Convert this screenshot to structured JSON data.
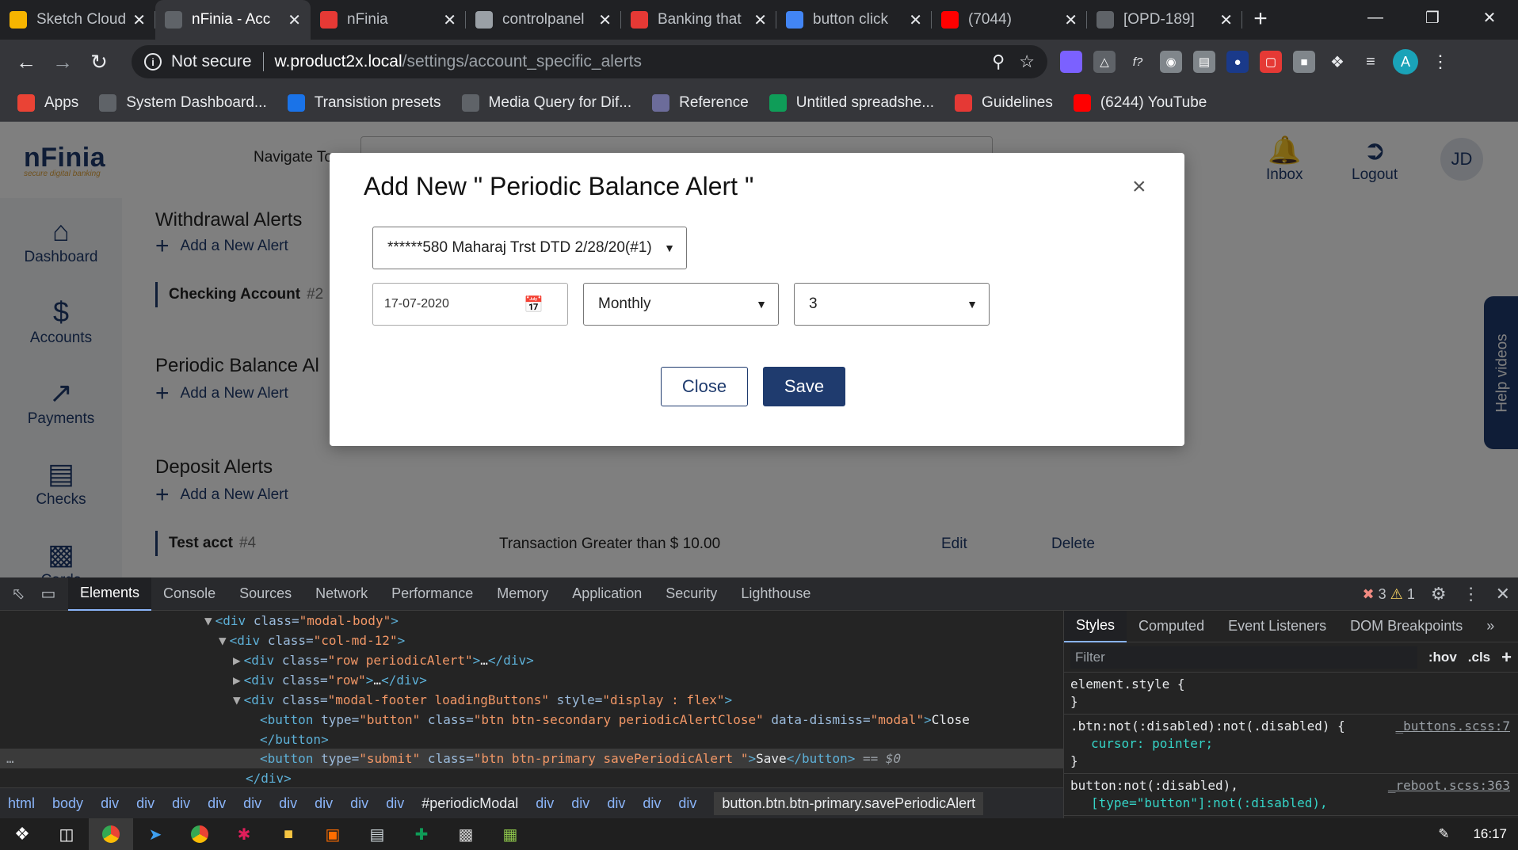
{
  "browser": {
    "tabs": [
      {
        "label": "Sketch Cloud",
        "color": "#f7b500",
        "active": false
      },
      {
        "label": "nFinia - Acc",
        "color": "#5f6368",
        "active": true
      },
      {
        "label": "nFinia",
        "color": "#e53935",
        "active": false
      },
      {
        "label": "controlpanel",
        "color": "#9aa0a6",
        "active": false
      },
      {
        "label": "Banking that",
        "color": "#e53935",
        "active": false
      },
      {
        "label": "button click",
        "color": "#4285f4",
        "active": false
      },
      {
        "label": "(7044)",
        "color": "#ff0000",
        "active": false
      },
      {
        "label": "[OPD-189]",
        "color": "#5f6368",
        "active": false
      }
    ],
    "address": {
      "security": "Not secure",
      "host": "w.product2x.local",
      "path": "/settings/account_specific_alerts"
    },
    "bookmarks": [
      {
        "label": "Apps",
        "color": "#ea4335"
      },
      {
        "label": "System Dashboard...",
        "color": "#5f6368"
      },
      {
        "label": "Transistion presets",
        "color": "#1a73e8"
      },
      {
        "label": "Media Query for Dif...",
        "color": "#5f6368"
      },
      {
        "label": "Reference",
        "color": "#6c6c9a"
      },
      {
        "label": "Untitled spreadshe...",
        "color": "#0f9d58"
      },
      {
        "label": "Guidelines",
        "color": "#e53935"
      },
      {
        "label": "(6244) YouTube",
        "color": "#ff0000"
      }
    ],
    "profile_initial": "A"
  },
  "app": {
    "logo": "nFinia",
    "tagline": "secure digital banking",
    "navigate_label": "Navigate To",
    "header": {
      "inbox": "Inbox",
      "logout": "Logout",
      "user_initials": "JD"
    },
    "sidebar": [
      {
        "label": "Dashboard",
        "icon": "home-icon"
      },
      {
        "label": "Accounts",
        "icon": "dollar-icon"
      },
      {
        "label": "Payments",
        "icon": "arrow-icon"
      },
      {
        "label": "Checks",
        "icon": "check-icon"
      },
      {
        "label": "Cards",
        "icon": "card-icon"
      }
    ],
    "sections": {
      "withdrawal_title": "Withdrawal Alerts",
      "add_alert": "Add a New Alert",
      "checking_account": "Checking Account",
      "checking_num": "#2",
      "periodic_title": "Periodic Balance Al",
      "deposit_title": "Deposit Alerts",
      "test_acct": "Test acct",
      "test_num": "#4",
      "test_desc": "Transaction Greater than $ 10.00",
      "edit": "Edit",
      "delete": "Delete"
    },
    "help_videos": "Help videos"
  },
  "modal": {
    "title": "Add New \" Periodic Balance Alert \"",
    "account": "******580 Maharaj Trst DTD 2/28/20(#1)",
    "date": "17-07-2020",
    "frequency": "Monthly",
    "day": "3",
    "close_label": "Close",
    "save_label": "Save"
  },
  "devtools": {
    "tabs": [
      "Elements",
      "Console",
      "Sources",
      "Network",
      "Performance",
      "Memory",
      "Application",
      "Security",
      "Lighthouse"
    ],
    "errors": "3",
    "warnings": "1",
    "lines": {
      "l1_tag": "<div ",
      "l1_attr": "class=",
      "l1_val": "\"modal-body\"",
      "l2_val": "\"col-md-12\"",
      "l3_val": "\"row periodicAlert\"",
      "l4_val": "\"row\"",
      "l5_val": "\"modal-footer loadingButtons\"",
      "l5_style_attr": " style=",
      "l5_style_val": "\"display : flex\"",
      "l6_type_val": "\"button\"",
      "l6_class_val": "\"btn btn-secondary periodicAlertClose\"",
      "l6_dismiss_attr": " data-dismiss=",
      "l6_dismiss_val": "\"modal\"",
      "l6_text": "Close",
      "l8_type_val": "\"submit\"",
      "l8_class_val": "\"btn btn-primary savePeriodicAlert \"",
      "l8_text": "Save",
      "l8_marker": " == $0"
    },
    "styles_tabs": [
      "Styles",
      "Computed",
      "Event Listeners",
      "DOM Breakpoints"
    ],
    "filter_placeholder": "Filter",
    "hov": ":hov",
    "cls": ".cls",
    "rules": [
      {
        "selector": "element.style {",
        "prop": "",
        "src": ""
      },
      {
        "selector": ".btn:not(:disabled):not(.disabled) {",
        "prop": "cursor: pointer;",
        "src": "_buttons.scss:7"
      },
      {
        "selector": "button:not(:disabled),",
        "prop": "[type=\"button\"]:not(:disabled),",
        "src": "_reboot.scss:363"
      }
    ],
    "breadcrumbs": [
      "html",
      "body",
      "div",
      "div",
      "div",
      "div",
      "div",
      "div",
      "div",
      "div",
      "div",
      "#periodicModal",
      "div",
      "div",
      "div",
      "div",
      "div"
    ],
    "breadcrumb_current": "button.btn.btn-primary.savePeriodicAlert"
  },
  "taskbar": {
    "time": "16:17"
  }
}
